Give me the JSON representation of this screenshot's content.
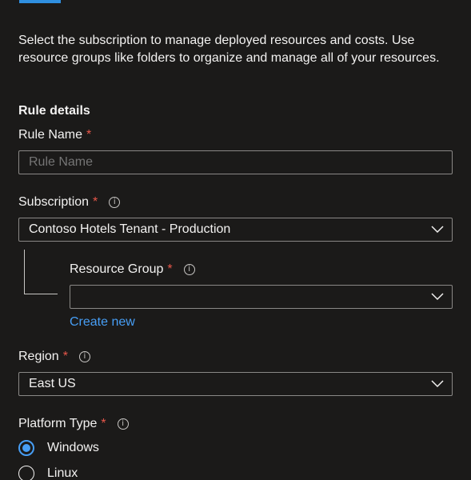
{
  "intro_text": "Select the subscription to manage deployed resources and costs. Use resource groups like folders to organize and manage all of your resources.",
  "section_title": "Rule details",
  "required_marker": "*",
  "info_glyph": "i",
  "rule_name": {
    "label": "Rule Name",
    "placeholder": "Rule Name",
    "value": ""
  },
  "subscription": {
    "label": "Subscription",
    "selected": "Contoso Hotels Tenant - Production"
  },
  "resource_group": {
    "label": "Resource Group",
    "selected": "",
    "create_new": "Create new"
  },
  "region": {
    "label": "Region",
    "selected": "East US"
  },
  "platform_type": {
    "label": "Platform Type",
    "options": [
      {
        "label": "Windows",
        "checked": true
      },
      {
        "label": "Linux",
        "checked": false
      }
    ]
  },
  "colors": {
    "background": "#1b1a19",
    "accent": "#479ef5",
    "required": "#e8574a",
    "border": "#8a8886"
  },
  "icons": [
    "info-icon",
    "chevron-down-icon",
    "radio-checked-icon",
    "radio-unchecked-icon"
  ]
}
